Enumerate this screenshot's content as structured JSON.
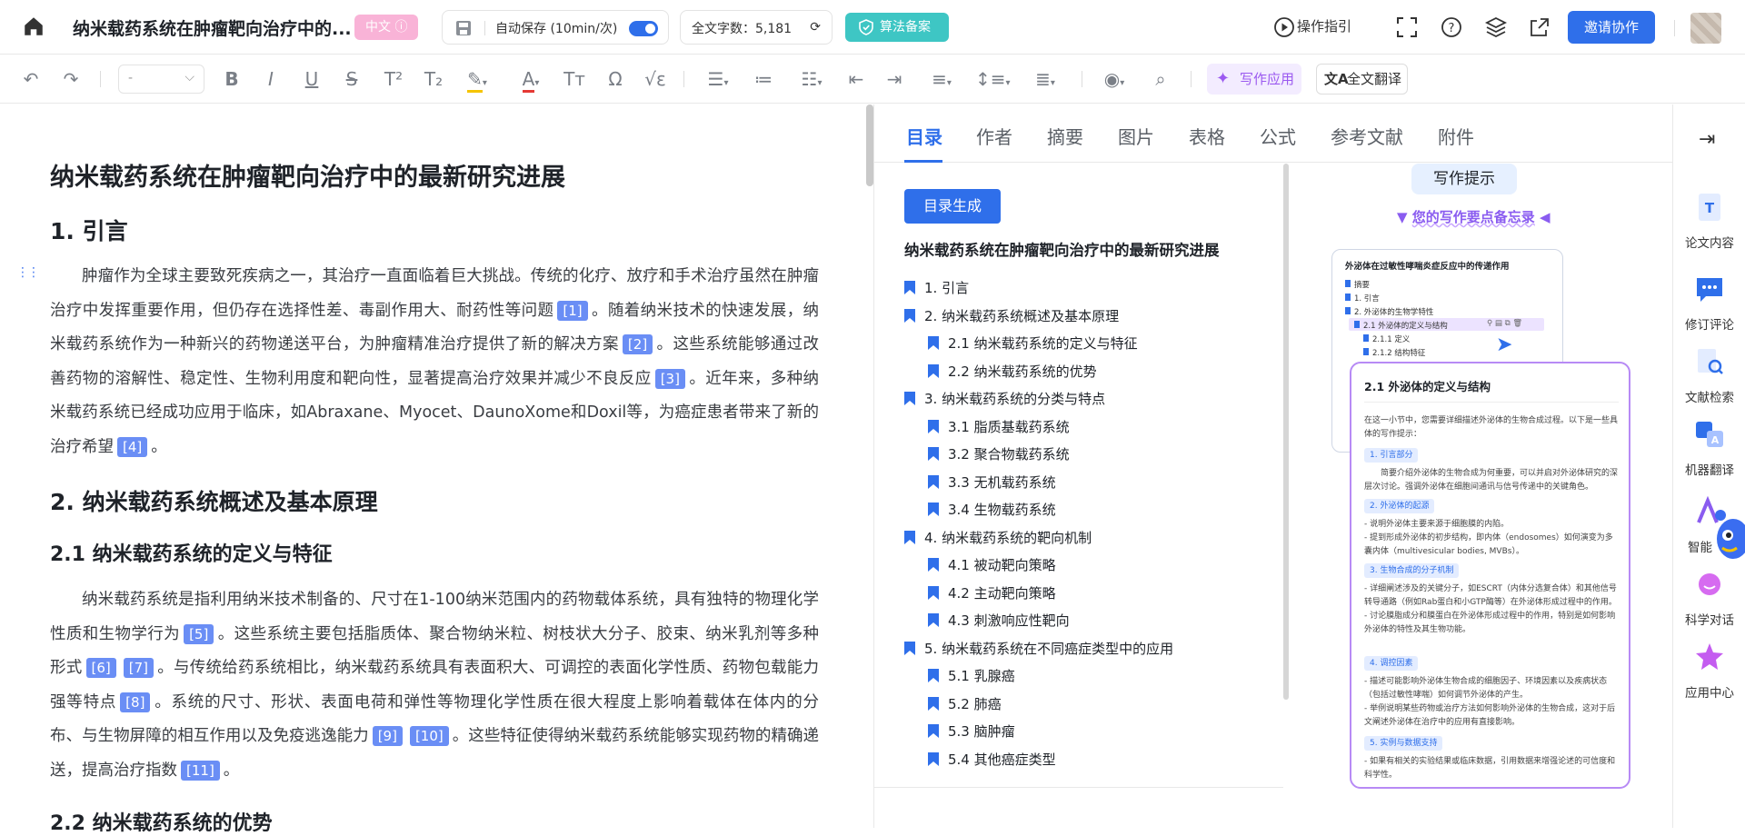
{
  "header": {
    "doc_title": "纳米载药系统在肿瘤靶向治疗中的...",
    "lang_badge": "中文",
    "autosave_label": "自动保存 (10min/次)",
    "word_count": "全文字数：5,181",
    "algo_btn": "算法备案",
    "guide": "操作指引",
    "invite_btn": "邀请协作"
  },
  "toolbar": {
    "font_select": "-",
    "ai_write": "写作应用",
    "full_translate": "全文翻译"
  },
  "editor": {
    "title": "纳米载药系统在肿瘤靶向治疗中的最新研究进展",
    "h_intro": "1. 引言",
    "p1": [
      "肿瘤作为全球主要致死疾病之一，其治疗一直面临着巨大挑战。传统的化疗、放疗和手术治疗虽然在肿瘤治疗中发挥重要作用，但仍存在选择性差、毒副作用大、耐药性等问题",
      "[1]",
      "。随着纳米技术的快速发展，纳米载药系统作为一种新兴的药物递送平台，为肿瘤精准治疗提供了新的解决方案",
      "[2]",
      "。这些系统能够通过改善药物的溶解性、稳定性、生物利用度和靶向性，显著提高治疗效果并减少不良反应",
      "[3]",
      "。近年来，多种纳米载药系统已经成功应用于临床，如Abraxane、Myocet、DaunoXome和Doxil等，为癌症患者带来了新的治疗希望",
      "[4]",
      "。"
    ],
    "h_sec2": "2. 纳米载药系统概述及基本原理",
    "h_sec21": "2.1 纳米载药系统的定义与特征",
    "p2": [
      "纳米载药系统是指利用纳米技术制备的、尺寸在1-100纳米范围内的药物载体系统，具有独特的物理化学性质和生物学行为",
      "[5]",
      "。这些系统主要包括脂质体、聚合物纳米粒、树枝状大分子、胶束、纳米乳剂等多种形式",
      "[6]",
      "[7]",
      "。与传统给药系统相比，纳米载药系统具有表面积大、可调控的表面化学性质、药物包载能力强等特点",
      "[8]",
      "。系统的尺寸、形状、表面电荷和弹性等物理化学性质在很大程度上影响着载体在体内的分布、与生物屏障的相互作用以及免疫逃逸能力",
      "[9]",
      "[10]",
      "。这些特征使得纳米载药系统能够实现药物的精确递送，提高治疗指数",
      "[11]",
      "。"
    ],
    "h_sec22": "2.2 纳米载药系统的优势"
  },
  "panel": {
    "tabs": [
      "目录",
      "作者",
      "摘要",
      "图片",
      "表格",
      "公式",
      "参考文献",
      "附件"
    ],
    "toc_button": "目录生成",
    "toc_title": "纳米载药系统在肿瘤靶向治疗中的最新研究进展",
    "toc": [
      {
        "label": "1. 引言",
        "level": 1
      },
      {
        "label": "2. 纳米载药系统概述及基本原理",
        "level": 1
      },
      {
        "label": "2.1 纳米载药系统的定义与特征",
        "level": 2
      },
      {
        "label": "2.2 纳米载药系统的优势",
        "level": 2
      },
      {
        "label": "3. 纳米载药系统的分类与特点",
        "level": 1
      },
      {
        "label": "3.1 脂质基载药系统",
        "level": 2
      },
      {
        "label": "3.2 聚合物载药系统",
        "level": 2
      },
      {
        "label": "3.3 无机载药系统",
        "level": 2
      },
      {
        "label": "3.4 生物载药系统",
        "level": 2
      },
      {
        "label": "4. 纳米载药系统的靶向机制",
        "level": 1
      },
      {
        "label": "4.1 被动靶向策略",
        "level": 2
      },
      {
        "label": "4.2 主动靶向策略",
        "level": 2
      },
      {
        "label": "4.3 刺激响应性靶向",
        "level": 2
      },
      {
        "label": "5. 纳米载药系统在不同癌症类型中的应用",
        "level": 1
      },
      {
        "label": "5.1 乳腺癌",
        "level": 2
      },
      {
        "label": "5.2 肺癌",
        "level": 2
      },
      {
        "label": "5.3 脑肿瘤",
        "level": 2
      },
      {
        "label": "5.4 其他癌症类型",
        "level": 2
      }
    ],
    "tips": {
      "header": "写作提示",
      "memo": "您的写作要点备忘录",
      "mini_title": "外泌体在过敏性哮喘炎症反应中的传递作用",
      "mini_items": [
        "摘要",
        "1. 引言",
        "2. 外泌体的生物学特性",
        "2.1 外泌体的定义与结构",
        "2.1.1 定义",
        "2.1.2 结构特征"
      ],
      "card_title": "2.1 外泌体的定义与结构",
      "card_intro": "在这一小节中，您需要详细描述外泌体的生物合成过程。以下是一些具体的写作提示：",
      "sections": [
        {
          "tag": "1. 引言部分",
          "text": "简要介绍外泌体的生物合成为何重要，可以并启对外泌体研究的深层次讨论。强调外泌体在细胞间通讯与信号传递中的关键角色。"
        },
        {
          "tag": "2. 外泌体的起源",
          "text": "- 说明外泌体主要来源于细胞膜的内陷。\n- 提到形成外泌体的初步结构，即内体（endosomes）如何演变为多囊内体（multivesicular bodies, MVBs）。"
        },
        {
          "tag": "3. 生物合成的分子机制",
          "text": "- 详细阐述涉及的关键分子，如ESCRT（内体分选复合体）和其他信号转导通路（例如Rab蛋白和小GTP酶等）在外泌体形成过程中的作用。\n- 讨论膜脂成分和膜蛋白在外泌体形成过程中的作用，特别是如何影响外泌体的特性及其生物功能。"
        },
        {
          "tag": "4. 调控因素",
          "text": "- 描述可能影响外泌体生物合成的细胞因子、环境因素以及疾病状态（包括过敏性哮喘）如何调节外泌体的产生。\n- 举例说明某些药物或治疗方法如何影响外泌体的生物合成，这对于后文阐述外泌体在治疗中的应用有直接影响。"
        },
        {
          "tag": "5. 实例与数据支持",
          "text": "- 如果有相关的实验结果或临床数据，引用数据来增强论述的可信度和科学性。"
        }
      ]
    }
  },
  "sidebar": {
    "items": [
      "论文内容",
      "修订评论",
      "文献检索",
      "机器翻译",
      "智能",
      "科学对话",
      "应用中心"
    ]
  },
  "colors": {
    "accent": "#2f6fea",
    "citation": "#6a8ef5",
    "purple": "#9b59f0",
    "teal": "#3ec6c4"
  }
}
